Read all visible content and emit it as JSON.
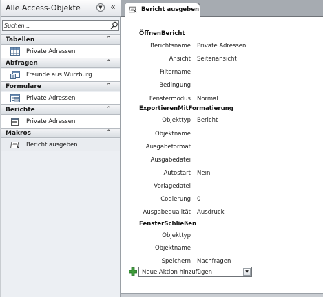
{
  "nav": {
    "title": "Alle Access-Objekte",
    "dropdown_icon": "chevron-down-circle-icon",
    "collapse_icon": "double-chevron-left-icon",
    "search_placeholder": "Suchen...",
    "groups": [
      {
        "label": "Tabellen",
        "items": [
          {
            "label": "Private Adressen",
            "icon": "table-icon"
          }
        ]
      },
      {
        "label": "Abfragen",
        "items": [
          {
            "label": "Freunde aus Würzburg",
            "icon": "query-icon"
          }
        ]
      },
      {
        "label": "Formulare",
        "items": [
          {
            "label": "Private Adressen",
            "icon": "form-icon"
          }
        ]
      },
      {
        "label": "Berichte",
        "items": [
          {
            "label": "Private Adressen",
            "icon": "report-icon"
          }
        ]
      },
      {
        "label": "Makros",
        "items": [
          {
            "label": "Bericht ausgeben",
            "icon": "macro-icon"
          }
        ]
      }
    ]
  },
  "tab": {
    "label": "Bericht ausgeben",
    "icon": "macro-icon"
  },
  "macro": {
    "actions": [
      {
        "name": "ÖffnenBericht",
        "args": [
          {
            "label": "Berichtsname",
            "value": "Private Adressen"
          },
          {
            "label": "Ansicht",
            "value": "Seitenansicht"
          },
          {
            "label": "Filtername",
            "value": ""
          },
          {
            "label": "Bedingung",
            "value": ""
          },
          {
            "label": "Fenstermodus",
            "value": "Normal"
          }
        ]
      },
      {
        "name": "ExportierenMitFormatierung",
        "args": [
          {
            "label": "Objekttyp",
            "value": "Bericht"
          },
          {
            "label": "Objektname",
            "value": ""
          },
          {
            "label": "Ausgabeformat",
            "value": ""
          },
          {
            "label": "Ausgabedatei",
            "value": ""
          },
          {
            "label": "Autostart",
            "value": "Nein"
          },
          {
            "label": "Vorlagedatei",
            "value": ""
          },
          {
            "label": "Codierung",
            "value": "0"
          },
          {
            "label": "Ausgabequalität",
            "value": "Ausdruck"
          }
        ]
      },
      {
        "name": "FensterSchließen",
        "args": [
          {
            "label": "Objekttyp",
            "value": ""
          },
          {
            "label": "Objektname",
            "value": ""
          },
          {
            "label": "Speichern",
            "value": "Nachfragen"
          }
        ]
      }
    ],
    "add_action_label": "Neue Aktion hinzufügen",
    "add_icon": "green-plus-icon"
  }
}
